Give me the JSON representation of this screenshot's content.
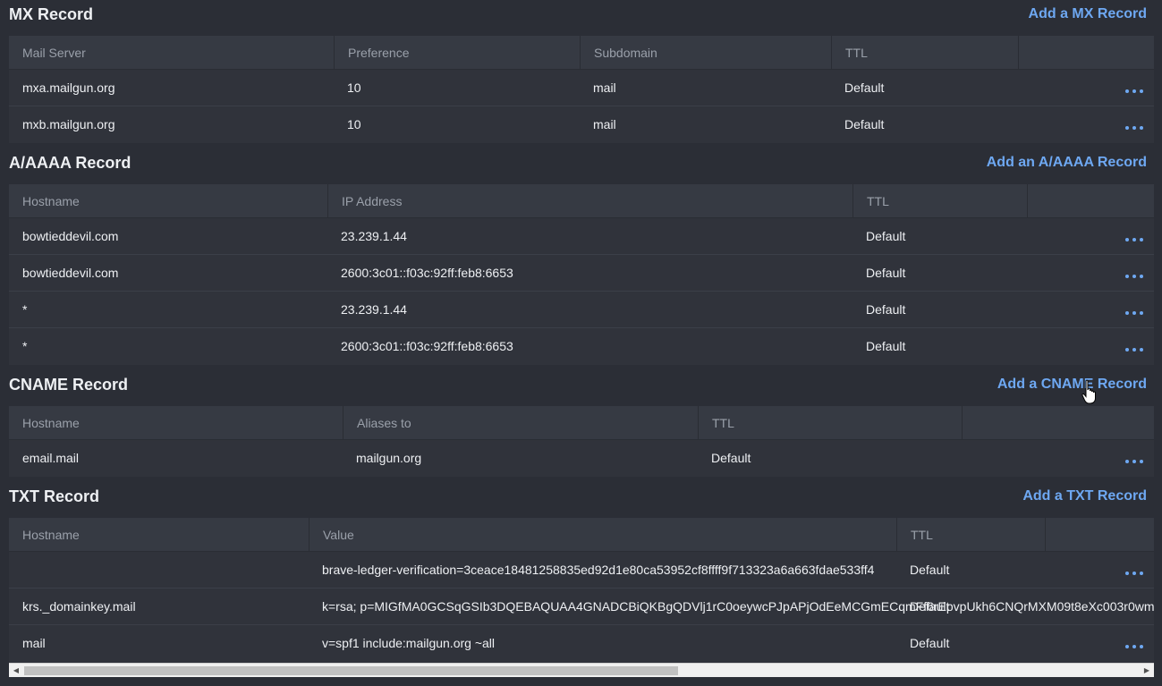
{
  "mx": {
    "title": "MX Record",
    "add_label": "Add a MX Record",
    "headers": [
      "Mail Server",
      "Preference",
      "Subdomain",
      "TTL"
    ],
    "rows": [
      [
        "mxa.mailgun.org",
        "10",
        "mail",
        "Default"
      ],
      [
        "mxb.mailgun.org",
        "10",
        "mail",
        "Default"
      ]
    ]
  },
  "a": {
    "title": "A/AAAA Record",
    "add_label": "Add an A/AAAA Record",
    "headers": [
      "Hostname",
      "IP Address",
      "TTL"
    ],
    "rows": [
      [
        "bowtieddevil.com",
        "23.239.1.44",
        "Default"
      ],
      [
        "bowtieddevil.com",
        "2600:3c01::f03c:92ff:feb8:6653",
        "Default"
      ],
      [
        "*",
        "23.239.1.44",
        "Default"
      ],
      [
        "*",
        "2600:3c01::f03c:92ff:feb8:6653",
        "Default"
      ]
    ]
  },
  "cname": {
    "title": "CNAME Record",
    "add_label": "Add a CNAME Record",
    "headers": [
      "Hostname",
      "Aliases to",
      "TTL"
    ],
    "rows": [
      [
        "email.mail",
        "mailgun.org",
        "Default"
      ]
    ]
  },
  "txt": {
    "title": "TXT Record",
    "add_label": "Add a TXT Record",
    "headers": [
      "Hostname",
      "Value",
      "TTL"
    ],
    "rows": [
      [
        "",
        "brave-ledger-verification=3ceace18481258835ed92d1e80ca53952cf8ffff9f713323a6a663fdae533ff4",
        "Default"
      ],
      [
        "krs._domainkey.mail",
        "k=rsa; p=MIGfMA0GCSqGSIb3DQEBAQUAA4GNADCBiQKBgQDVlj1rC0oeywcPJpAPjOdEeMCGmECqmFf6rEpvpUkh6CNQrMXM09t8eXc003r0wm",
        "Default"
      ],
      [
        "mail",
        "v=spf1 include:mailgun.org ~all",
        "Default"
      ]
    ]
  },
  "icons": {
    "row_menu": "more-horizontal-icon",
    "scroll_left": "scroll-left-arrow-icon",
    "scroll_right": "scroll-right-arrow-icon",
    "cursor": "hand-pointer-icon"
  },
  "colors": {
    "background": "#2b2e36",
    "header_bg": "#363a43",
    "link": "#6ea8f2",
    "text": "#eef0f3",
    "muted": "#9aa0aa"
  }
}
